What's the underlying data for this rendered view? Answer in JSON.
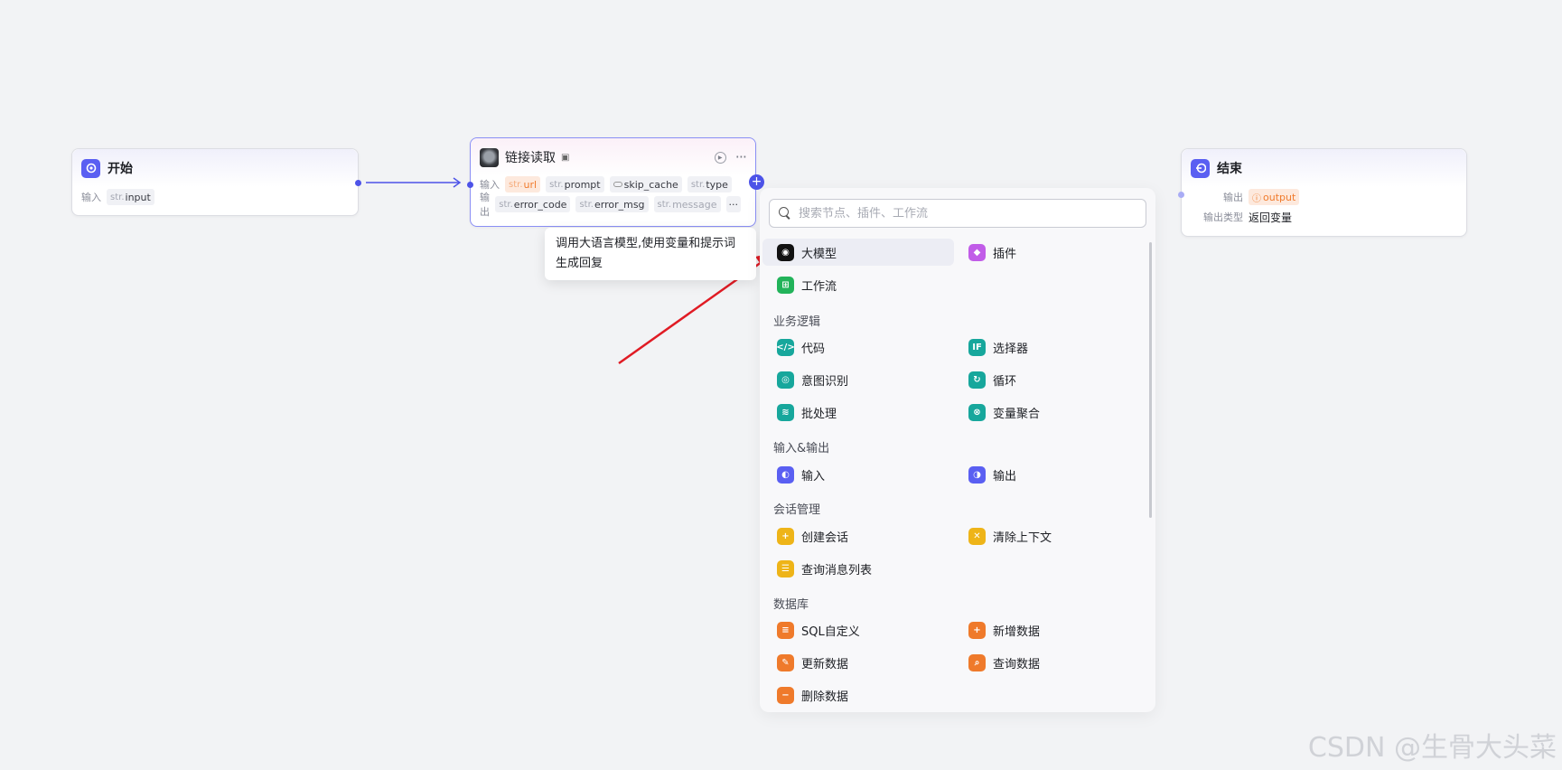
{
  "start_node": {
    "title": "开始",
    "input_label": "输入",
    "input_type": "str.",
    "input_name": "input"
  },
  "link_node": {
    "title": "链接读取",
    "input_label": "输入",
    "output_label": "输出",
    "inputs": [
      {
        "type": "str.",
        "name": "url",
        "highlight": true
      },
      {
        "type": "str.",
        "name": "prompt"
      },
      {
        "type": "",
        "name": "skip_cache"
      },
      {
        "type": "str.",
        "name": "type"
      }
    ],
    "outputs": [
      {
        "type": "str.",
        "name": "error_code"
      },
      {
        "type": "str.",
        "name": "error_msg"
      },
      {
        "type": "str.",
        "name": "message"
      }
    ],
    "more_label": "···"
  },
  "end_node": {
    "title": "结束",
    "output_label": "输出",
    "output_var": "output",
    "output_type_label": "输出类型",
    "output_type_value": "返回变量"
  },
  "tooltip": {
    "text": "调用大语言模型,使用变量和提示词生成回复"
  },
  "panel": {
    "search_placeholder": "搜索节点、插件、工作流",
    "top_items": [
      {
        "label": "大模型",
        "icon": "llm-icon",
        "color": "#111111",
        "active": true
      },
      {
        "label": "插件",
        "icon": "plugin-icon",
        "color": "#c15ce8"
      },
      {
        "label": "工作流",
        "icon": "workflow-icon",
        "color": "#22b35a"
      }
    ],
    "sections": [
      {
        "title": "业务逻辑",
        "items": [
          {
            "label": "代码",
            "icon": "code-icon",
            "color": "#17a79c"
          },
          {
            "label": "选择器",
            "icon": "if-icon",
            "color": "#17a79c"
          },
          {
            "label": "意图识别",
            "icon": "intent-icon",
            "color": "#17a79c"
          },
          {
            "label": "循环",
            "icon": "loop-icon",
            "color": "#17a79c"
          },
          {
            "label": "批处理",
            "icon": "batch-icon",
            "color": "#17a79c"
          },
          {
            "label": "变量聚合",
            "icon": "aggregate-icon",
            "color": "#17a79c"
          }
        ]
      },
      {
        "title": "输入&输出",
        "items": [
          {
            "label": "输入",
            "icon": "input-icon",
            "color": "#5a5ff2"
          },
          {
            "label": "输出",
            "icon": "output-icon",
            "color": "#5a5ff2"
          }
        ]
      },
      {
        "title": "会话管理",
        "items": [
          {
            "label": "创建会话",
            "icon": "create-conversation-icon",
            "color": "#eeb418"
          },
          {
            "label": "清除上下文",
            "icon": "clear-context-icon",
            "color": "#eeb418"
          },
          {
            "label": "查询消息列表",
            "icon": "query-messages-icon",
            "color": "#eeb418"
          }
        ]
      },
      {
        "title": "数据库",
        "items": [
          {
            "label": "SQL自定义",
            "icon": "sql-icon",
            "color": "#ef7a2b"
          },
          {
            "label": "新增数据",
            "icon": "add-data-icon",
            "color": "#ef7a2b"
          },
          {
            "label": "更新数据",
            "icon": "update-data-icon",
            "color": "#ef7a2b"
          },
          {
            "label": "查询数据",
            "icon": "query-data-icon",
            "color": "#ef7a2b"
          },
          {
            "label": "删除数据",
            "icon": "delete-data-icon",
            "color": "#ef7a2b"
          }
        ]
      }
    ]
  },
  "watermark": "CSDN @生骨大头菜"
}
